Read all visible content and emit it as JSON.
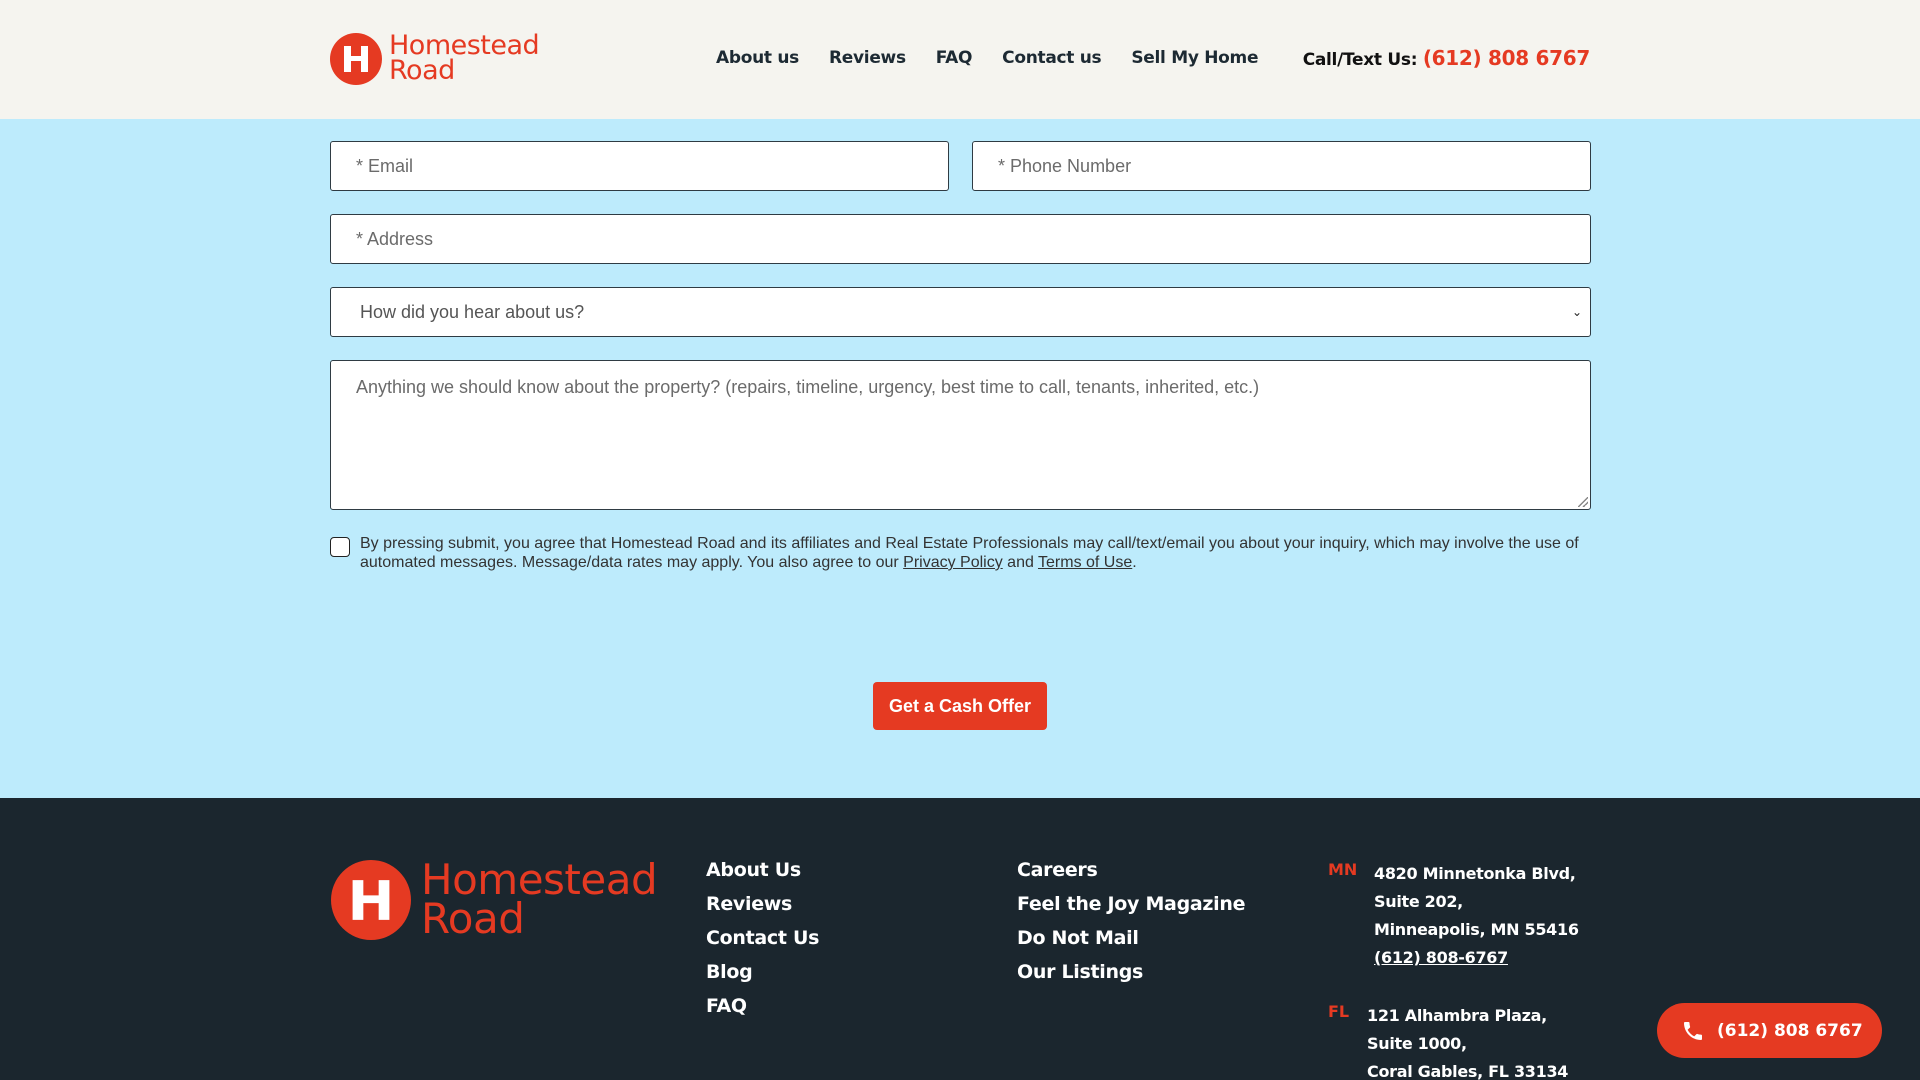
{
  "brand": {
    "name_line1": "Homestead",
    "name_line2": "Road",
    "color": "#E53A22"
  },
  "nav": {
    "items": [
      "About us",
      "Reviews",
      "FAQ",
      "Contact us",
      "Sell My Home"
    ]
  },
  "header_call": {
    "label": "Call/Text Us:",
    "phone": "(612) 808 6767"
  },
  "form": {
    "email_placeholder": "* Email",
    "phone_placeholder": "* Phone Number",
    "address_placeholder": "* Address",
    "source_selected": "How did you hear about us?",
    "notes_placeholder": "Anything we should know about the property? (repairs, timeline, urgency, best time to call, tenants, inherited, etc.)",
    "consent_text_1": "By pressing submit, you agree that Homestead Road and its affiliates and Real Estate Professionals may call/text/email you about your inquiry, which may involve the use of automated messages. Message/data rates may apply.  You also agree to our ",
    "privacy_link": "Privacy Policy",
    "consent_and": " and ",
    "terms_link": "Terms of Use",
    "consent_end": ".",
    "submit_label": "Get a Cash Offer"
  },
  "footer": {
    "col1": [
      "About Us",
      "Reviews",
      "Contact Us",
      "Blog",
      "FAQ"
    ],
    "col2": [
      "Careers",
      "Feel the Joy Magazine",
      "Do Not Mail",
      "Our Listings"
    ],
    "offices": [
      {
        "state": "MN",
        "line1": "4820 Minnetonka Blvd,",
        "line2": "Suite 202,",
        "line3": "Minneapolis, MN 55416",
        "phone": "(612) 808-6767"
      },
      {
        "state": "FL",
        "line1": "121 Alhambra Plaza,",
        "line2": "Suite 1000,",
        "line3": "Coral Gables, FL 33134"
      }
    ]
  },
  "floating_call": {
    "phone": "(612) 808 6767"
  }
}
